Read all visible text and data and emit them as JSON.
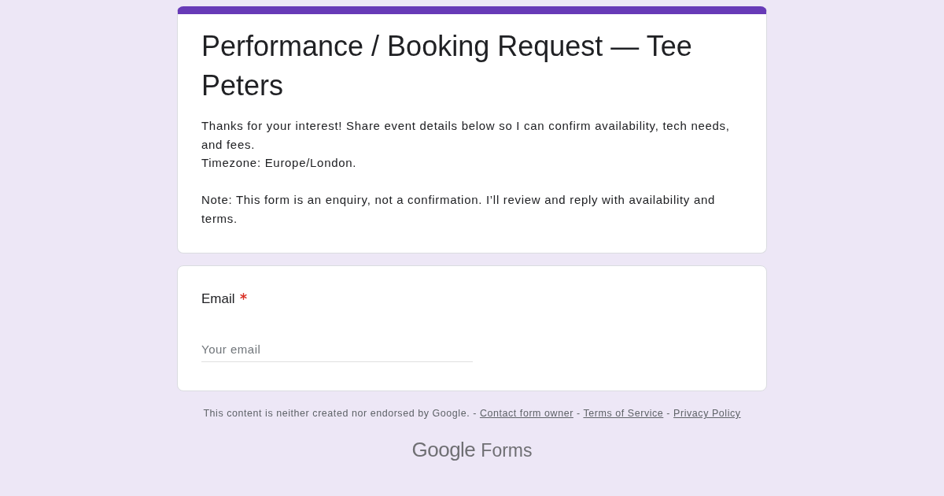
{
  "header": {
    "title": "Performance / Booking Request — Tee Peters",
    "description": "Thanks for your interest! Share event details below so I can confirm availability, tech needs, and fees.\nTimezone: Europe/London.\n\nNote: This form is an enquiry, not a confirmation. I’ll review and reply with availability and terms."
  },
  "questions": [
    {
      "kind": "short_text",
      "label": "Email",
      "required": true,
      "placeholder": "Your email"
    }
  ],
  "footer": {
    "disclaimer": "This content is neither created nor endorsed by Google.",
    "separator": "-",
    "links": [
      "Contact form owner",
      "Terms of Service",
      "Privacy Policy"
    ],
    "logo": {
      "brand": "Google",
      "product": "Forms"
    }
  }
}
